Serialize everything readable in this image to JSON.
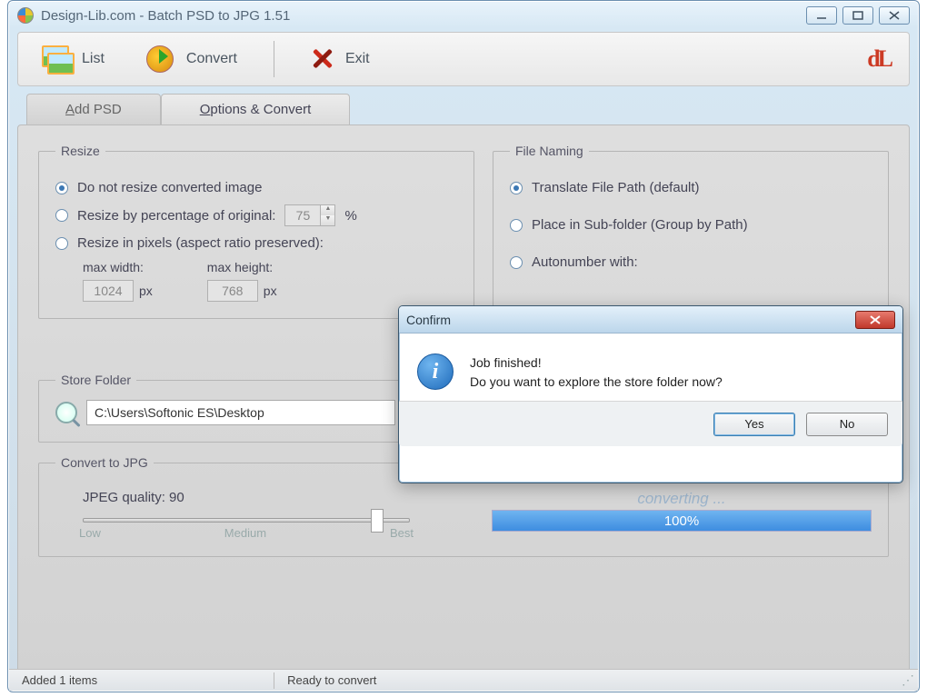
{
  "window": {
    "title": "Design-Lib.com - Batch PSD to JPG 1.51"
  },
  "toolbar": {
    "list": "List",
    "convert": "Convert",
    "exit": "Exit",
    "logo": "dL"
  },
  "tabs": {
    "add": "Add PSD",
    "options": "Options & Convert"
  },
  "resize": {
    "legend": "Resize",
    "opt_none": "Do not resize converted image",
    "opt_pct": "Resize by percentage of original:",
    "pct_value": "75",
    "pct_unit": "%",
    "opt_px": "Resize in pixels (aspect ratio preserved):",
    "maxw_label": "max width:",
    "maxw_value": "1024",
    "maxh_label": "max height:",
    "maxh_value": "768",
    "px_unit": "px"
  },
  "naming": {
    "legend": "File Naming",
    "opt_translate": "Translate File Path (default)",
    "opt_sub": "Place in Sub-folder (Group by Path)",
    "opt_auto": "Autonumber with:"
  },
  "store": {
    "legend": "Store Folder",
    "path": "C:\\Users\\Softonic ES\\Desktop"
  },
  "convert": {
    "legend": "Convert to JPG",
    "quality_label": "JPEG quality: 90",
    "low": "Low",
    "medium": "Medium",
    "best": "Best",
    "status": "converting ...",
    "pct": "100%"
  },
  "status": {
    "added": "Added 1 items",
    "ready": "Ready to convert"
  },
  "dialog": {
    "title": "Confirm",
    "line1": "Job finished!",
    "line2": "Do you want to explore the store folder now?",
    "yes": "Yes",
    "no": "No"
  }
}
